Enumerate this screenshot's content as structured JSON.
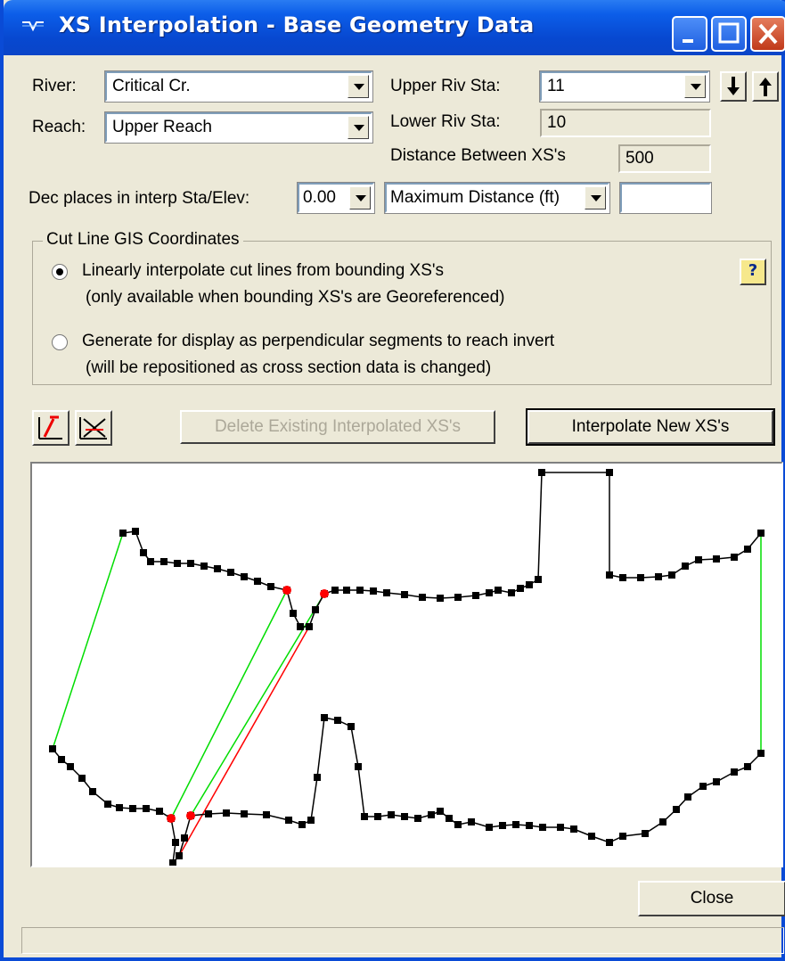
{
  "window": {
    "title": "XS Interpolation  - Base Geometry Data"
  },
  "fields": {
    "river_label": "River:",
    "river_value": "Critical Cr.",
    "reach_label": "Reach:",
    "reach_value": "Upper Reach",
    "upper_riv_sta_label": "Upper Riv Sta:",
    "upper_riv_sta_value": "11",
    "lower_riv_sta_label": "Lower Riv Sta:",
    "lower_riv_sta_value": "10",
    "distance_label": "Distance Between XS's",
    "distance_value": "500",
    "dec_places_label": "Dec places in interp Sta/Elev:",
    "dec_places_value": "0.00",
    "max_distance_value": "Maximum Distance (ft)",
    "max_distance_input": ""
  },
  "cutline": {
    "group_title": "Cut Line GIS Coordinates",
    "option1_line1": "Linearly interpolate cut lines from bounding XS's",
    "option1_line2": "(only available when bounding XS's are Georeferenced)",
    "option2_line1": "Generate for display as perpendicular segments to reach invert",
    "option2_line2": "(will be repositioned as cross section data is changed)",
    "selected": 1
  },
  "buttons": {
    "delete_label": "Delete Existing Interpolated XS's",
    "interpolate_label": "Interpolate New XS's",
    "close_label": "Close"
  },
  "icons": {
    "down": "arrow-down-icon",
    "up": "arrow-up-icon",
    "help": "help-icon",
    "tool1": "draw-line-icon",
    "tool2": "clear-lines-icon"
  },
  "colors": {
    "titlebar": "#0a4bd6",
    "connector_green": "#00dd00",
    "connector_red": "#ff0000",
    "point_black": "#000000",
    "match_point_red": "#ff0000"
  }
}
